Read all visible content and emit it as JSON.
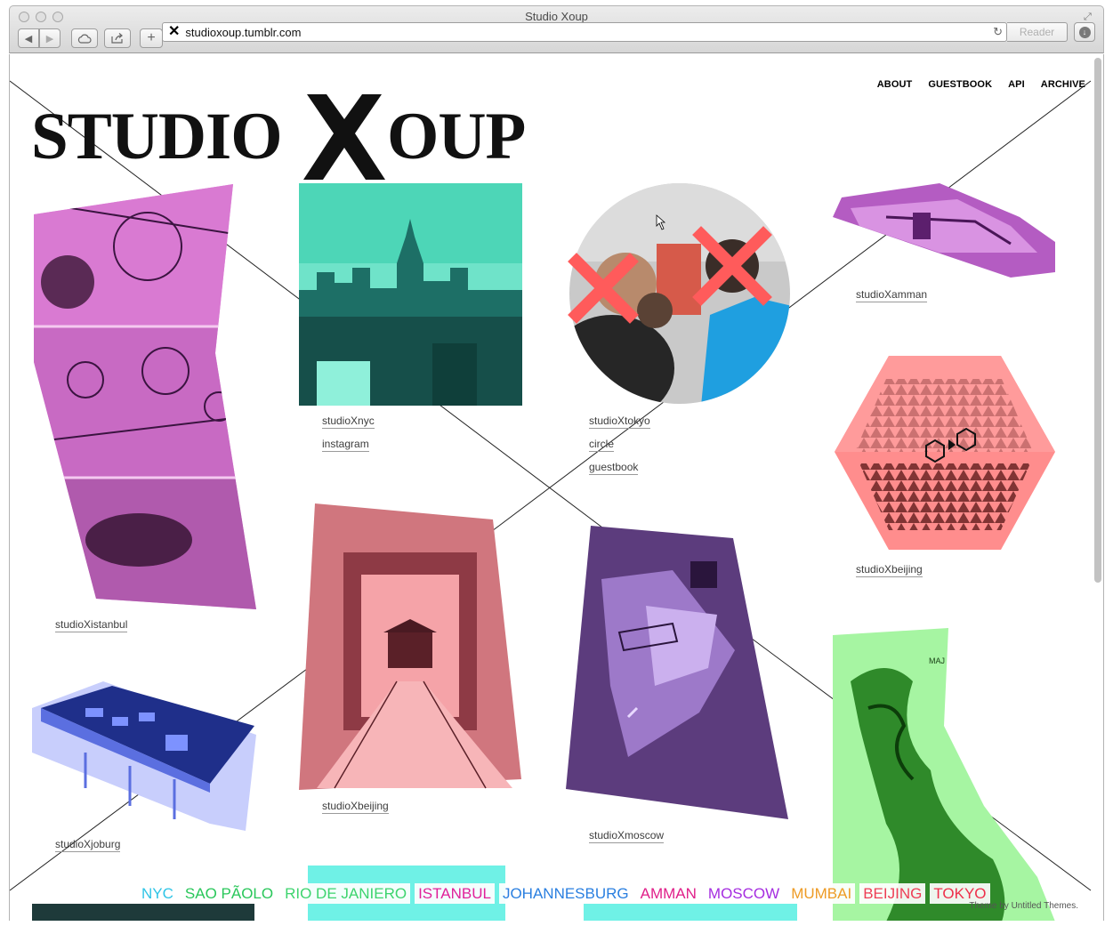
{
  "window": {
    "title": "Studio Xoup",
    "url": "studioxoup.tumblr.com",
    "reader_label": "Reader"
  },
  "nav": [
    "ABOUT",
    "GUESTBOOK",
    "API",
    "ARCHIVE"
  ],
  "logo": {
    "text_left": "STUDIO",
    "text_right": "OUP"
  },
  "tiles": {
    "istanbul": {
      "links": [
        "studioXistanbul"
      ]
    },
    "nyc": {
      "links": [
        "studioXnyc",
        "instagram"
      ]
    },
    "tokyo": {
      "links": [
        "studioXtokyo",
        "circle",
        "guestbook"
      ]
    },
    "amman": {
      "links": [
        "studioXamman"
      ]
    },
    "beijing_hex": {
      "links": [
        "studioXbeijing"
      ]
    },
    "beijing_gate": {
      "links": [
        "studioXbeijing"
      ]
    },
    "moscow": {
      "links": [
        "studioXmoscow"
      ]
    },
    "joburg": {
      "links": [
        "studioXjoburg"
      ]
    },
    "map": {
      "label": "MAJ"
    }
  },
  "cities": [
    {
      "name": "NYC",
      "color": "#2ec4e6"
    },
    {
      "name": "SAO PÃOLO",
      "color": "#29c75a"
    },
    {
      "name": "RIO DE JANIERO",
      "color": "#3dd46e"
    },
    {
      "name": "ISTANBUL",
      "color": "#e0209a"
    },
    {
      "name": "JOHANNESBURG",
      "color": "#2a7fe0"
    },
    {
      "name": "AMMAN",
      "color": "#e0208a"
    },
    {
      "name": "MOSCOW",
      "color": "#a52de0"
    },
    {
      "name": "MUMBAI",
      "color": "#ee9b25"
    },
    {
      "name": "BEIJING",
      "color": "#ee3d55"
    },
    {
      "name": "TOKYO",
      "color": "#ee2f4a"
    }
  ],
  "credit": "Theme by Untitled Themes."
}
